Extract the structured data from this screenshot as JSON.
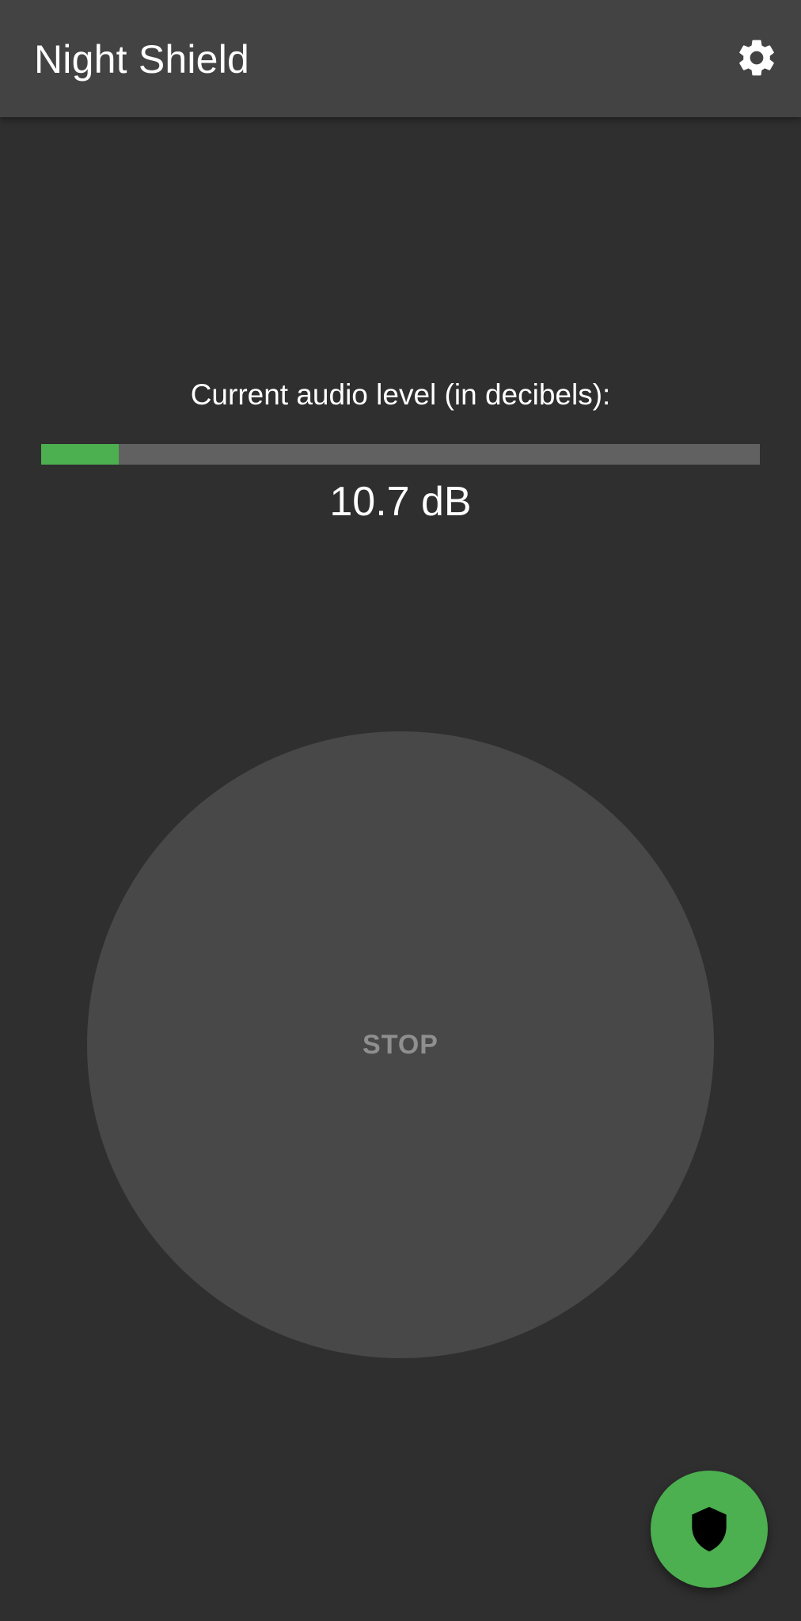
{
  "appbar": {
    "title": "Night Shield",
    "settings_icon": "gear-icon"
  },
  "meter": {
    "label": "Current audio level (in decibels):",
    "level_fraction": 0.108,
    "readout": "10.7 dB",
    "fill_color": "#4caf50",
    "track_color": "#616161"
  },
  "main": {
    "stop_label": "STOP"
  },
  "fab": {
    "icon": "shield-icon",
    "color": "#4caf50"
  }
}
